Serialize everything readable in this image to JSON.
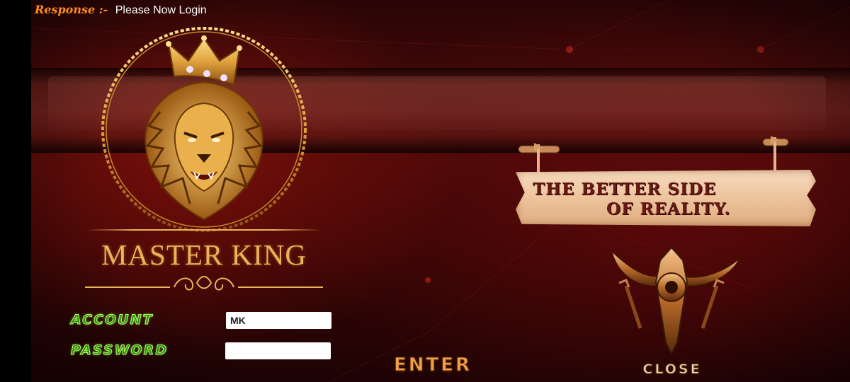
{
  "response": {
    "label": "Response :-",
    "message": "Please Now Login"
  },
  "brand": {
    "name": "MASTER KING",
    "logo_icon": "crowned-lion-icon"
  },
  "login_form": {
    "account_label": "ACCOUNT",
    "account_value": "MK",
    "password_label": "PASSWORD",
    "password_value": "",
    "enter_label": "ENTER"
  },
  "sign": {
    "line1": "THE BETTER SIDE",
    "line2": "OF REALITY."
  },
  "close": {
    "label": "CLOSE",
    "icon": "crest-emblem-icon"
  },
  "colors": {
    "background": "#3a0606",
    "gold": "#e8b35a",
    "label_green": "#2f8f12",
    "response_orange": "#ff8a1c",
    "sign_board": "#edc49c",
    "sign_text": "#6a1a14"
  }
}
